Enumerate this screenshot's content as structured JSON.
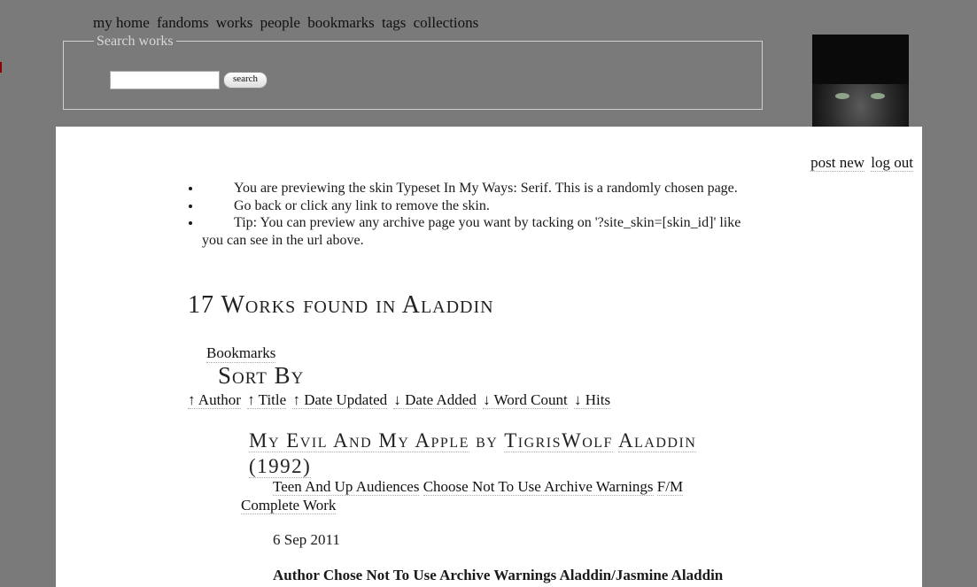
{
  "nav": [
    "my home",
    "fandoms",
    "works",
    "people",
    "bookmarks",
    "tags",
    "collections"
  ],
  "search": {
    "legend": "Search works",
    "button": "search",
    "value": ""
  },
  "user_links": {
    "post_new": "post new",
    "log_out": "log out"
  },
  "notice": [
    "You are previewing the skin Typeset In My Ways: Serif. This is a randomly chosen page.",
    "Go back or click any link to remove the skin.",
    "Tip: You can preview any archive page you want by tacking on '?site_skin=[skin_id]' like you can see in the url above."
  ],
  "heading": "17 Works found in Aladdin",
  "bookmarks_link": "Bookmarks",
  "sort_by": "Sort By",
  "sort_links": [
    "↑ Author",
    "↑ Title",
    "↑ Date Updated",
    "↓ Date Added",
    "↓ Word Count",
    "↓ Hits"
  ],
  "work": {
    "title": "My Evil And My Apple",
    "by": "by",
    "author": "TigrisWolf",
    "fandom": "Aladdin (1992)",
    "rating": "Teen And Up Audiences",
    "warnings": "Choose Not To Use Archive Warnings",
    "category": "F/M",
    "status": "Complete Work",
    "date": "6 Sep 2011",
    "tags_line": "Author Chose Not To Use Archive Warnings Aladdin/Jasmine Aladdin"
  }
}
